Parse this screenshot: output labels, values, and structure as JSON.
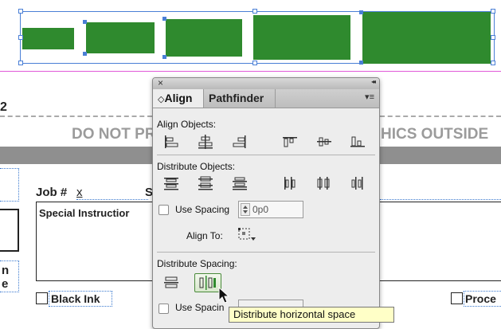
{
  "document": {
    "banner_text": "DO NOT PR",
    "banner_text_right": "HICS OUTSIDE",
    "left_fragment": "2",
    "job_label": "Job #",
    "job_value": "x",
    "job_trailing": "S",
    "special_instructions": "Special Instructior",
    "side_fragment_1": "n",
    "side_fragment_2": "e",
    "black_ink": "Black Ink",
    "process": "Proce"
  },
  "panel": {
    "close_glyph": "×",
    "collapse_glyph": "◂◂",
    "tabs": [
      {
        "label": "Align",
        "prefix": "◇",
        "active": true
      },
      {
        "label": "Pathfinder",
        "active": false
      }
    ],
    "menu_glyph": "▾≡",
    "align_objects_label": "Align Objects:",
    "distribute_objects_label": "Distribute Objects:",
    "use_spacing_label": "Use Spacing",
    "spacing_value": "0p0",
    "align_to_label": "Align To:",
    "distribute_spacing_label": "Distribute Spacing:",
    "use_spacing_label_2": "Use Spacin",
    "align_icons": [
      "align-left-edges-icon",
      "align-horizontal-centers-icon",
      "align-right-edges-icon",
      "align-top-edges-icon",
      "align-vertical-centers-icon",
      "align-bottom-edges-icon"
    ],
    "distribute_icons": [
      "distribute-top-edges-icon",
      "distribute-vertical-centers-icon",
      "distribute-bottom-edges-icon",
      "distribute-left-edges-icon",
      "distribute-horizontal-centers-icon",
      "distribute-right-edges-icon"
    ],
    "spacing_icons": [
      "distribute-vertical-space-icon",
      "distribute-horizontal-space-icon"
    ]
  },
  "tooltip": {
    "text": "Distribute horizontal space"
  },
  "colors": {
    "object_fill": "#2f8a2e",
    "selection": "#4a7fd6",
    "guide": "#e05ad8",
    "tooltip_bg": "#ffffc7"
  }
}
